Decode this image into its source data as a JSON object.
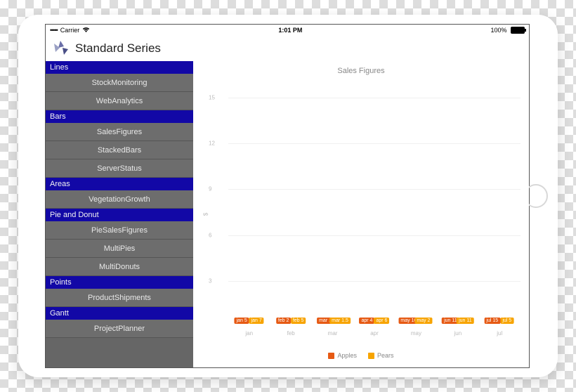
{
  "statusbar": {
    "carrier": "Carrier",
    "time": "1:01 PM",
    "battery_pct": "100%"
  },
  "header": {
    "title": "Standard Series"
  },
  "sidebar": {
    "sections": [
      {
        "label": "Lines",
        "items": [
          "StockMonitoring",
          "WebAnalytics"
        ]
      },
      {
        "label": "Bars",
        "items": [
          "SalesFigures",
          "StackedBars",
          "ServerStatus"
        ]
      },
      {
        "label": "Areas",
        "items": [
          "VegetationGrowth"
        ]
      },
      {
        "label": "Pie and Donut",
        "items": [
          "PieSalesFigures",
          "MultiPies",
          "MultiDonuts"
        ]
      },
      {
        "label": "Points",
        "items": [
          "ProductShipments"
        ]
      },
      {
        "label": "Gantt",
        "items": [
          "ProjectPlanner"
        ]
      }
    ]
  },
  "chart_data": {
    "type": "bar",
    "title": "Sales Figures",
    "ylabel": "$",
    "ylim": [
      0,
      16
    ],
    "yticks": [
      3,
      6,
      9,
      12,
      15
    ],
    "categories": [
      "jan",
      "feb",
      "mar",
      "apr",
      "may",
      "jun",
      "jul"
    ],
    "series": [
      {
        "name": "Apples",
        "color": "#e65a14",
        "values": [
          5,
          2,
          1,
          4,
          10,
          11,
          15
        ],
        "labels": [
          "jan 5",
          "feb 2",
          "mar 1",
          "apr 4",
          "may 10",
          "jun 11",
          "jul 15"
        ]
      },
      {
        "name": "Pears",
        "color": "#f7a400",
        "values": [
          7,
          5,
          1.5,
          6,
          2,
          11,
          5
        ],
        "labels": [
          "jan 7",
          "feb 5",
          "mar 1.5",
          "apr 6",
          "may 2",
          "jun 11",
          "jul 5"
        ]
      }
    ]
  },
  "legend": {
    "a": "Apples",
    "b": "Pears"
  }
}
